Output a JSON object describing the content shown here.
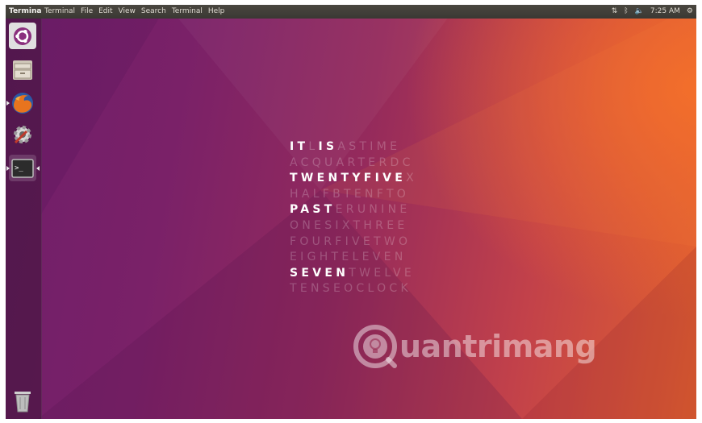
{
  "top_panel": {
    "app_title": "Termina",
    "menu": [
      "Terminal",
      "File",
      "Edit",
      "View",
      "Search",
      "Terminal",
      "Help"
    ],
    "indicators": {
      "network": "network-icon",
      "bluetooth": "bluetooth-icon",
      "sound": "volume-icon",
      "time": "7:25 AM",
      "session": "gear-icon"
    }
  },
  "launcher": [
    {
      "name": "dash",
      "icon": "ubuntu-logo-icon"
    },
    {
      "name": "files",
      "icon": "file-cabinet-icon"
    },
    {
      "name": "firefox",
      "icon": "firefox-icon"
    },
    {
      "name": "system-settings",
      "icon": "settings-icon"
    },
    {
      "name": "terminal",
      "icon": "terminal-icon"
    },
    {
      "name": "trash",
      "icon": "trash-icon"
    }
  ],
  "word_clock": {
    "rows": [
      [
        {
          "t": "IT",
          "lit": true
        },
        {
          "t": "L",
          "lit": false
        },
        {
          "t": "IS",
          "lit": true
        },
        {
          "t": "ASTIME",
          "lit": false
        }
      ],
      [
        {
          "t": "ACQUARTERDC",
          "lit": false
        }
      ],
      [
        {
          "t": "TWENTYFIVE",
          "lit": true
        },
        {
          "t": "X",
          "lit": false
        }
      ],
      [
        {
          "t": "HALFBTENFTO",
          "lit": false
        }
      ],
      [
        {
          "t": "PAST",
          "lit": true
        },
        {
          "t": "ERUNINE",
          "lit": false
        }
      ],
      [
        {
          "t": "ONESIXTHREE",
          "lit": false
        }
      ],
      [
        {
          "t": "FOURFIVETWO",
          "lit": false
        }
      ],
      [
        {
          "t": "EIGHTELEVEN",
          "lit": false
        }
      ],
      [
        {
          "t": "SEVEN",
          "lit": true
        },
        {
          "t": "TWELVE",
          "lit": false
        }
      ],
      [
        {
          "t": "TENSEOCLOCK",
          "lit": false
        }
      ]
    ]
  },
  "watermark": {
    "icon": "lightbulb-gear-icon",
    "text": "uantrimang"
  },
  "colors": {
    "panel": "#3c3b37",
    "accent_orange": "#e95420",
    "aubergine": "#77216f"
  }
}
